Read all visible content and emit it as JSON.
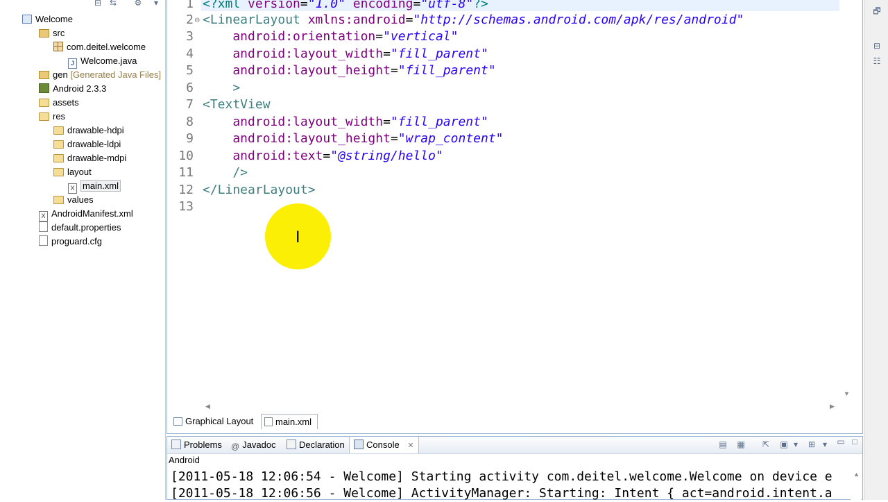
{
  "explorer": {
    "items": [
      {
        "label": "Welcome",
        "icon": "project-icon",
        "annotation": ""
      },
      {
        "label": "src",
        "icon": "source-folder-icon",
        "annotation": ""
      },
      {
        "label": "com.deitel.welcome",
        "icon": "package-icon",
        "annotation": ""
      },
      {
        "label": "Welcome.java",
        "icon": "java-file-icon",
        "annotation": ""
      },
      {
        "label": "gen",
        "icon": "source-folder-icon",
        "annotation": "[Generated Java Files]"
      },
      {
        "label": "Android 2.3.3",
        "icon": "library-icon",
        "annotation": ""
      },
      {
        "label": "assets",
        "icon": "folder-icon",
        "annotation": ""
      },
      {
        "label": "res",
        "icon": "folder-icon",
        "annotation": ""
      },
      {
        "label": "drawable-hdpi",
        "icon": "folder-icon",
        "annotation": ""
      },
      {
        "label": "drawable-ldpi",
        "icon": "folder-icon",
        "annotation": ""
      },
      {
        "label": "drawable-mdpi",
        "icon": "folder-icon",
        "annotation": ""
      },
      {
        "label": "layout",
        "icon": "folder-icon",
        "annotation": ""
      },
      {
        "label": "main.xml",
        "icon": "xml-file-icon",
        "annotation": ""
      },
      {
        "label": "values",
        "icon": "folder-icon",
        "annotation": ""
      },
      {
        "label": "AndroidManifest.xml",
        "icon": "xml-file-icon",
        "annotation": ""
      },
      {
        "label": "default.properties",
        "icon": "file-icon",
        "annotation": ""
      },
      {
        "label": "proguard.cfg",
        "icon": "file-icon",
        "annotation": ""
      }
    ]
  },
  "editor": {
    "line_numbers": [
      "1",
      "2",
      "3",
      "4",
      "5",
      "6",
      "7",
      "8",
      "9",
      "10",
      "11",
      "12",
      "13"
    ],
    "lines": {
      "l1": {
        "a": "<?xml ",
        "b": "version",
        "c": "=",
        "d": "\"1.0\"",
        "e": " ",
        "f": "encoding",
        "g": "=",
        "h": "\"utf-8\"",
        "i": "?>"
      },
      "l2": {
        "a": "<LinearLayout ",
        "b": "xmlns:android",
        "c": "=",
        "d": "\"http://schemas.android.com/apk/res/android\""
      },
      "l3": {
        "a": "    android:orientation",
        "b": "=",
        "c": "\"vertical\""
      },
      "l4": {
        "a": "    android:layout_width",
        "b": "=",
        "c": "\"fill_parent\""
      },
      "l5": {
        "a": "    android:layout_height",
        "b": "=",
        "c": "\"fill_parent\""
      },
      "l6": {
        "a": "    >"
      },
      "l7": {
        "a": "<TextView"
      },
      "l8": {
        "a": "    android:layout_width",
        "b": "=",
        "c": "\"fill_parent\""
      },
      "l9": {
        "a": "    android:layout_height",
        "b": "=",
        "c": "\"wrap_content\""
      },
      "l10": {
        "a": "    android:text",
        "b": "=",
        "c": "\"@string/hello\""
      },
      "l11": {
        "a": "    />"
      },
      "l12": {
        "a": "</LinearLayout>"
      }
    },
    "tabs": [
      {
        "label": "Graphical Layout"
      },
      {
        "label": "main.xml"
      }
    ]
  },
  "console": {
    "tabs": [
      {
        "label": "Problems"
      },
      {
        "label": "Javadoc"
      },
      {
        "label": "Declaration"
      },
      {
        "label": "Console"
      }
    ],
    "title": "Android",
    "lines": [
      "[2011-05-18 12:06:54 - Welcome] Starting activity com.deitel.welcome.Welcome on device e",
      "[2011-05-18 12:06:56 - Welcome] ActivityManager: Starting: Intent { act=android.intent.a"
    ]
  },
  "colors": {
    "tag": "#3f7f7f",
    "attribute": "#7f007f",
    "value": "#2a00ff",
    "cursor_highlight": "#fbf005",
    "line_number": "#787878"
  }
}
